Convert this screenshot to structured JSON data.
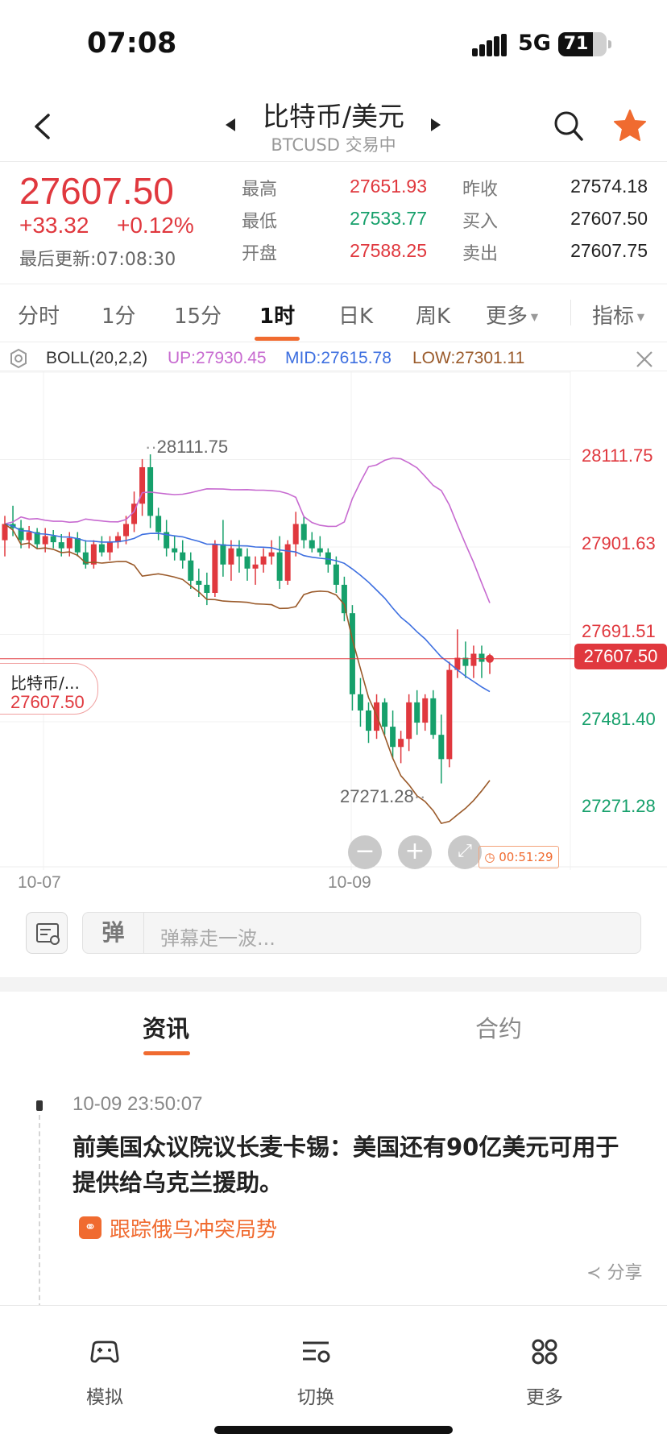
{
  "status_bar": {
    "time": "07:08",
    "network": "5G",
    "battery": "71",
    "battery_level": 0.71
  },
  "header": {
    "title": "比特币/美元",
    "subtitle": "BTCUSD 交易中",
    "icons": [
      "back-arrow-icon",
      "prev-triangle-icon",
      "next-triangle-icon",
      "search-icon",
      "star-icon"
    ],
    "accent": "#f06b30"
  },
  "quote": {
    "price": "27607.50",
    "change": "+33.32",
    "change_pct": "+0.12%",
    "updated": "最后更新:07:08:30",
    "stats": [
      {
        "label": "最高",
        "value": "27651.93",
        "color": "#e0383e"
      },
      {
        "label": "最低",
        "value": "27533.77",
        "color": "#16a06b"
      },
      {
        "label": "开盘",
        "value": "27588.25",
        "color": "#e0383e"
      },
      {
        "label": "昨收",
        "value": "27574.18",
        "color": "#222222"
      },
      {
        "label": "买入",
        "value": "27607.50",
        "color": "#222222"
      },
      {
        "label": "卖出",
        "value": "27607.75",
        "color": "#222222"
      }
    ]
  },
  "tabs": {
    "items": [
      "分时",
      "1分",
      "15分",
      "1时",
      "日K",
      "周K",
      "更多"
    ],
    "active": "1时",
    "indicator": "指标"
  },
  "boll": {
    "name": "BOLL(20,2,2)",
    "up": "UP:27930.45",
    "mid": "MID:27615.78",
    "low": "LOW:27301.11",
    "colors": {
      "up": "#c76ad0",
      "mid": "#3d6fe0",
      "low": "#9a5a2a"
    }
  },
  "chart": {
    "high_marker": "28111.75",
    "low_marker": "27271.28",
    "y_labels": [
      "28111.75",
      "27901.63",
      "27691.51",
      "27481.40",
      "27271.28"
    ],
    "current_price": "27607.50",
    "x_labels": [
      "10-07",
      "10-09"
    ],
    "bubble": {
      "name": "比特币/...",
      "price": "27607.50"
    },
    "timer": "00:51:29",
    "colors": {
      "up": "#e0383e",
      "down": "#16a06b"
    }
  },
  "chart_data": {
    "type": "candlestick",
    "timeframe": "1时",
    "x_labels": [
      "10-07",
      "10-09"
    ],
    "ylim": [
      27271.28,
      28111.75
    ],
    "y_ticks": [
      28111.75,
      27901.63,
      27691.51,
      27481.4,
      27271.28
    ],
    "last": 27607.5,
    "candles": [
      [
        27900,
        27960,
        27860,
        27940
      ],
      [
        27940,
        27985,
        27910,
        27930
      ],
      [
        27930,
        27950,
        27880,
        27900
      ],
      [
        27900,
        27935,
        27880,
        27920
      ],
      [
        27920,
        27930,
        27880,
        27890
      ],
      [
        27890,
        27930,
        27870,
        27910
      ],
      [
        27910,
        27925,
        27880,
        27895
      ],
      [
        27895,
        27915,
        27860,
        27880
      ],
      [
        27880,
        27920,
        27860,
        27905
      ],
      [
        27905,
        27920,
        27860,
        27870
      ],
      [
        27870,
        27900,
        27830,
        27840
      ],
      [
        27840,
        27900,
        27830,
        27890
      ],
      [
        27890,
        27910,
        27860,
        27870
      ],
      [
        27870,
        27910,
        27850,
        27895
      ],
      [
        27895,
        27920,
        27880,
        27910
      ],
      [
        27910,
        27960,
        27890,
        27940
      ],
      [
        27940,
        28020,
        27920,
        27990
      ],
      [
        27990,
        28100,
        27960,
        28080
      ],
      [
        28080,
        28111.75,
        27930,
        27960
      ],
      [
        27960,
        27980,
        27900,
        27920
      ],
      [
        27920,
        27950,
        27860,
        27880
      ],
      [
        27880,
        27910,
        27850,
        27870
      ],
      [
        27870,
        27900,
        27830,
        27850
      ],
      [
        27850,
        27870,
        27780,
        27800
      ],
      [
        27800,
        27830,
        27760,
        27790
      ],
      [
        27790,
        27820,
        27740,
        27770
      ],
      [
        27770,
        27900,
        27760,
        27890
      ],
      [
        27890,
        27950,
        27810,
        27840
      ],
      [
        27840,
        27900,
        27800,
        27880
      ],
      [
        27880,
        27900,
        27820,
        27860
      ],
      [
        27860,
        27880,
        27800,
        27830
      ],
      [
        27830,
        27860,
        27790,
        27840
      ],
      [
        27840,
        27880,
        27820,
        27860
      ],
      [
        27860,
        27900,
        27840,
        27870
      ],
      [
        27870,
        27910,
        27780,
        27800
      ],
      [
        27800,
        27900,
        27790,
        27890
      ],
      [
        27890,
        27970,
        27860,
        27940
      ],
      [
        27940,
        27960,
        27880,
        27900
      ],
      [
        27900,
        27920,
        27870,
        27880
      ],
      [
        27880,
        27910,
        27860,
        27870
      ],
      [
        27870,
        27880,
        27820,
        27840
      ],
      [
        27840,
        27860,
        27770,
        27790
      ],
      [
        27790,
        27810,
        27700,
        27720
      ],
      [
        27720,
        27740,
        27480,
        27520
      ],
      [
        27520,
        27560,
        27440,
        27480
      ],
      [
        27480,
        27500,
        27400,
        27430
      ],
      [
        27430,
        27520,
        27410,
        27500
      ],
      [
        27500,
        27510,
        27420,
        27440
      ],
      [
        27440,
        27480,
        27360,
        27390
      ],
      [
        27390,
        27430,
        27350,
        27410
      ],
      [
        27410,
        27520,
        27380,
        27500
      ],
      [
        27500,
        27530,
        27420,
        27450
      ],
      [
        27450,
        27520,
        27430,
        27510
      ],
      [
        27510,
        27530,
        27410,
        27420
      ],
      [
        27420,
        27470,
        27300,
        27360
      ],
      [
        27360,
        27600,
        27340,
        27580
      ],
      [
        27580,
        27680,
        27560,
        27610
      ],
      [
        27610,
        27650,
        27560,
        27590
      ],
      [
        27590,
        27640,
        27560,
        27620
      ],
      [
        27620,
        27640,
        27560,
        27600
      ],
      [
        27600,
        27620,
        27570,
        27607.5
      ]
    ],
    "series": [
      {
        "name": "UP",
        "last": 27930.45
      },
      {
        "name": "MID",
        "last": 27615.78
      },
      {
        "name": "LOW",
        "last": 27301.11
      }
    ]
  },
  "danmu": {
    "badge": "弹",
    "placeholder": "弹幕走一波..."
  },
  "news_tabs": {
    "items": [
      "资讯",
      "合约"
    ],
    "active": "资讯"
  },
  "news": {
    "time": "10-09 23:50:07",
    "title": "前美国众议院议长麦卡锡：美国还有90亿美元可用于提供给乌克兰援助。",
    "topic": "跟踪俄乌冲突局势",
    "share": "分享"
  },
  "bottom_nav": {
    "items": [
      {
        "label": "模拟",
        "icon": "gamepad-icon"
      },
      {
        "label": "切换",
        "icon": "switch-icon"
      },
      {
        "label": "更多",
        "icon": "grid-icon"
      }
    ]
  }
}
